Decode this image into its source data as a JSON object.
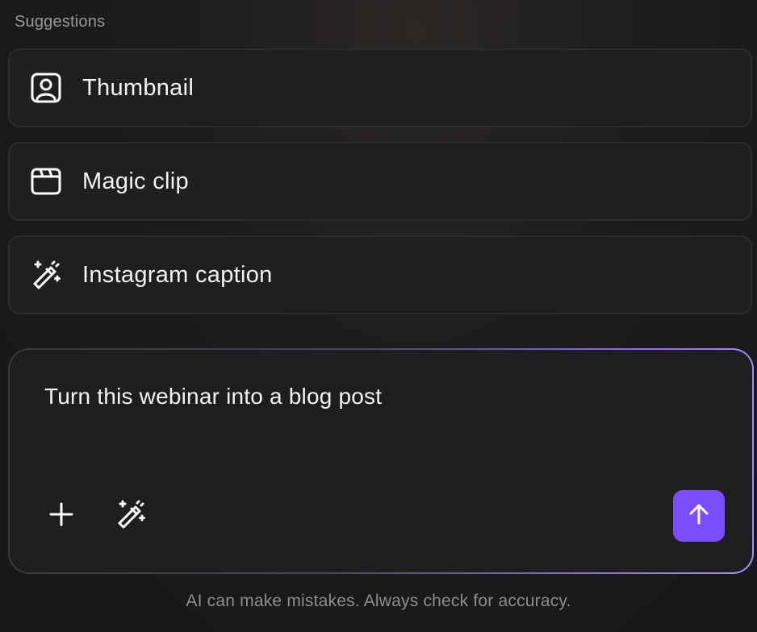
{
  "suggestions": {
    "heading": "Suggestions",
    "items": [
      {
        "label": "Thumbnail",
        "icon": "portrait-frame-icon"
      },
      {
        "label": "Magic clip",
        "icon": "clapperboard-icon"
      },
      {
        "label": "Instagram caption",
        "icon": "magic-wand-icon"
      }
    ]
  },
  "composer": {
    "prompt": "Turn this webinar into a blog post",
    "tools": [
      {
        "icon": "plus-icon"
      },
      {
        "icon": "magic-wand-icon"
      }
    ],
    "send_icon": "arrow-up-icon",
    "accent_color": "#7c4dff"
  },
  "footer": {
    "disclaimer": "AI can make mistakes. Always check for accuracy."
  }
}
